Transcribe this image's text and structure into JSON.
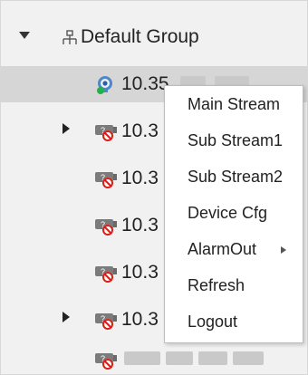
{
  "tree": {
    "root_label": "Default Group",
    "devices": [
      {
        "ip": "10.35",
        "status": "online",
        "selected": true,
        "has_children": false
      },
      {
        "ip": "10.3",
        "status": "offline",
        "selected": false,
        "has_children": true
      },
      {
        "ip": "10.3",
        "status": "offline",
        "selected": false,
        "has_children": false
      },
      {
        "ip": "10.3",
        "status": "offline",
        "selected": false,
        "has_children": false
      },
      {
        "ip": "10.3",
        "status": "offline",
        "selected": false,
        "has_children": false
      },
      {
        "ip": "10.3",
        "status": "offline",
        "selected": false,
        "has_children": true
      }
    ]
  },
  "context_menu": {
    "items": [
      {
        "label": "Main Stream"
      },
      {
        "label": "Sub Stream1"
      },
      {
        "label": "Sub Stream2"
      },
      {
        "label": "Device Cfg"
      },
      {
        "label": "AlarmOut",
        "has_submenu": true
      },
      {
        "label": "Refresh"
      },
      {
        "label": "Logout"
      }
    ]
  },
  "colors": {
    "online_status": "#22b14c",
    "offline_status": "#d91e18",
    "selection": "#d6d6d6"
  }
}
